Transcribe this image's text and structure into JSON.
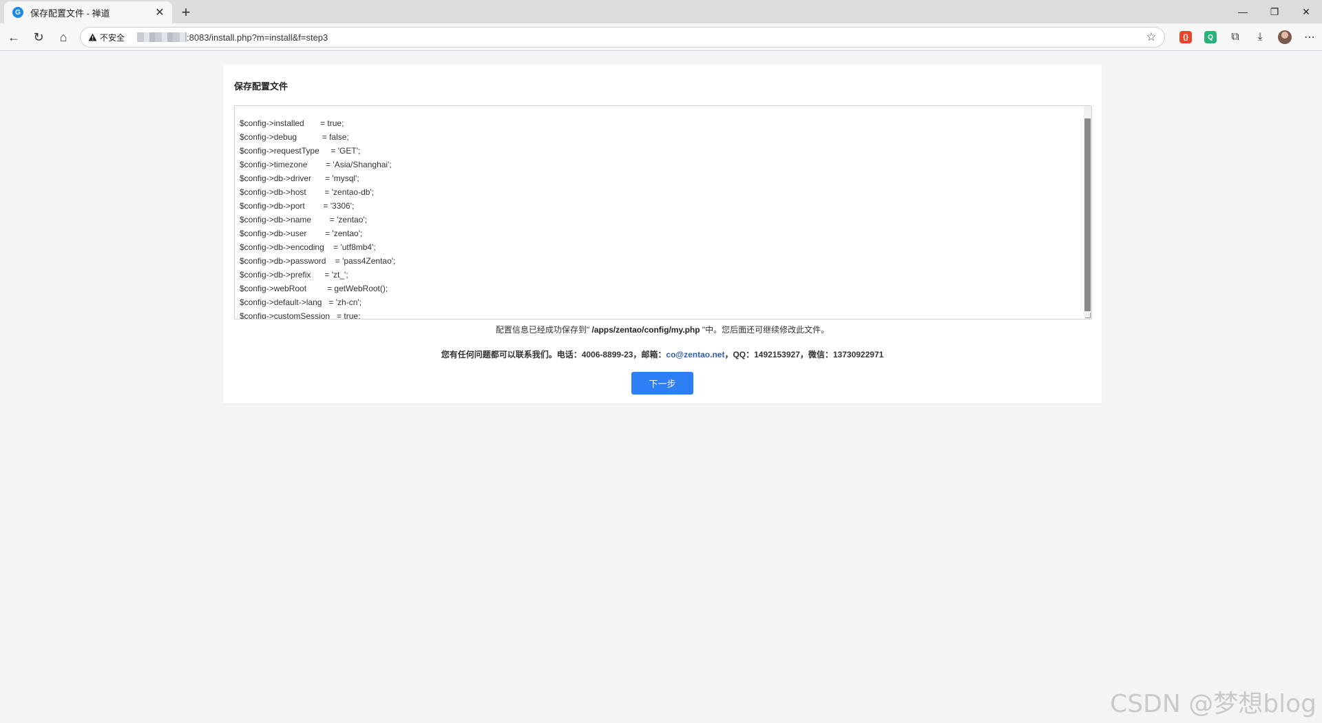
{
  "browser": {
    "tab_title": "保存配置文件 - 禅道",
    "tab_favicon_glyph": "G",
    "new_tab_glyph": "+",
    "close_glyph": "✕",
    "window": {
      "minimize": "—",
      "restore": "❐",
      "close": "✕"
    },
    "nav": {
      "back": "←",
      "reload": "↻",
      "home": "⌂"
    },
    "security_label": "不安全",
    "url_visible": ":8083/install.php?m=install&f=step3",
    "star_glyph": "☆",
    "extensions": {
      "red_glyph": "{}",
      "green_glyph": "Q",
      "puzzle_glyph": "⧉",
      "download_glyph": "⤓",
      "menu_glyph": "⋯"
    }
  },
  "panel": {
    "title": "保存配置文件",
    "config_lines": [
      "$config->installed       = true;",
      "$config->debug           = false;",
      "$config->requestType     = 'GET';",
      "$config->timezone        = 'Asia/Shanghai';",
      "$config->db->driver      = 'mysql';",
      "$config->db->host        = 'zentao-db';",
      "$config->db->port        = '3306';",
      "$config->db->name        = 'zentao';",
      "$config->db->user        = 'zentao';",
      "$config->db->encoding    = 'utf8mb4';",
      "$config->db->password    = 'pass4Zentao';",
      "$config->db->prefix      = 'zt_';",
      "$config->webRoot         = getWebRoot();",
      "$config->default->lang   = 'zh-cn';",
      "$config->customSession   = true;"
    ],
    "save_msg_prefix": "配置信息已经成功保存到\" ",
    "save_msg_path": "/apps/zentao/config/my.php",
    "save_msg_suffix": " \"中。您后面还可继续修改此文件。",
    "contact_prefix": "您有任何问题都可以联系我们。电话：4006-8899-23，邮箱：",
    "contact_email": "co@zentao.net",
    "contact_suffix": "，QQ：1492153927，微信：13730922971",
    "next_button": "下一步"
  },
  "watermark": "CSDN @梦想blog"
}
